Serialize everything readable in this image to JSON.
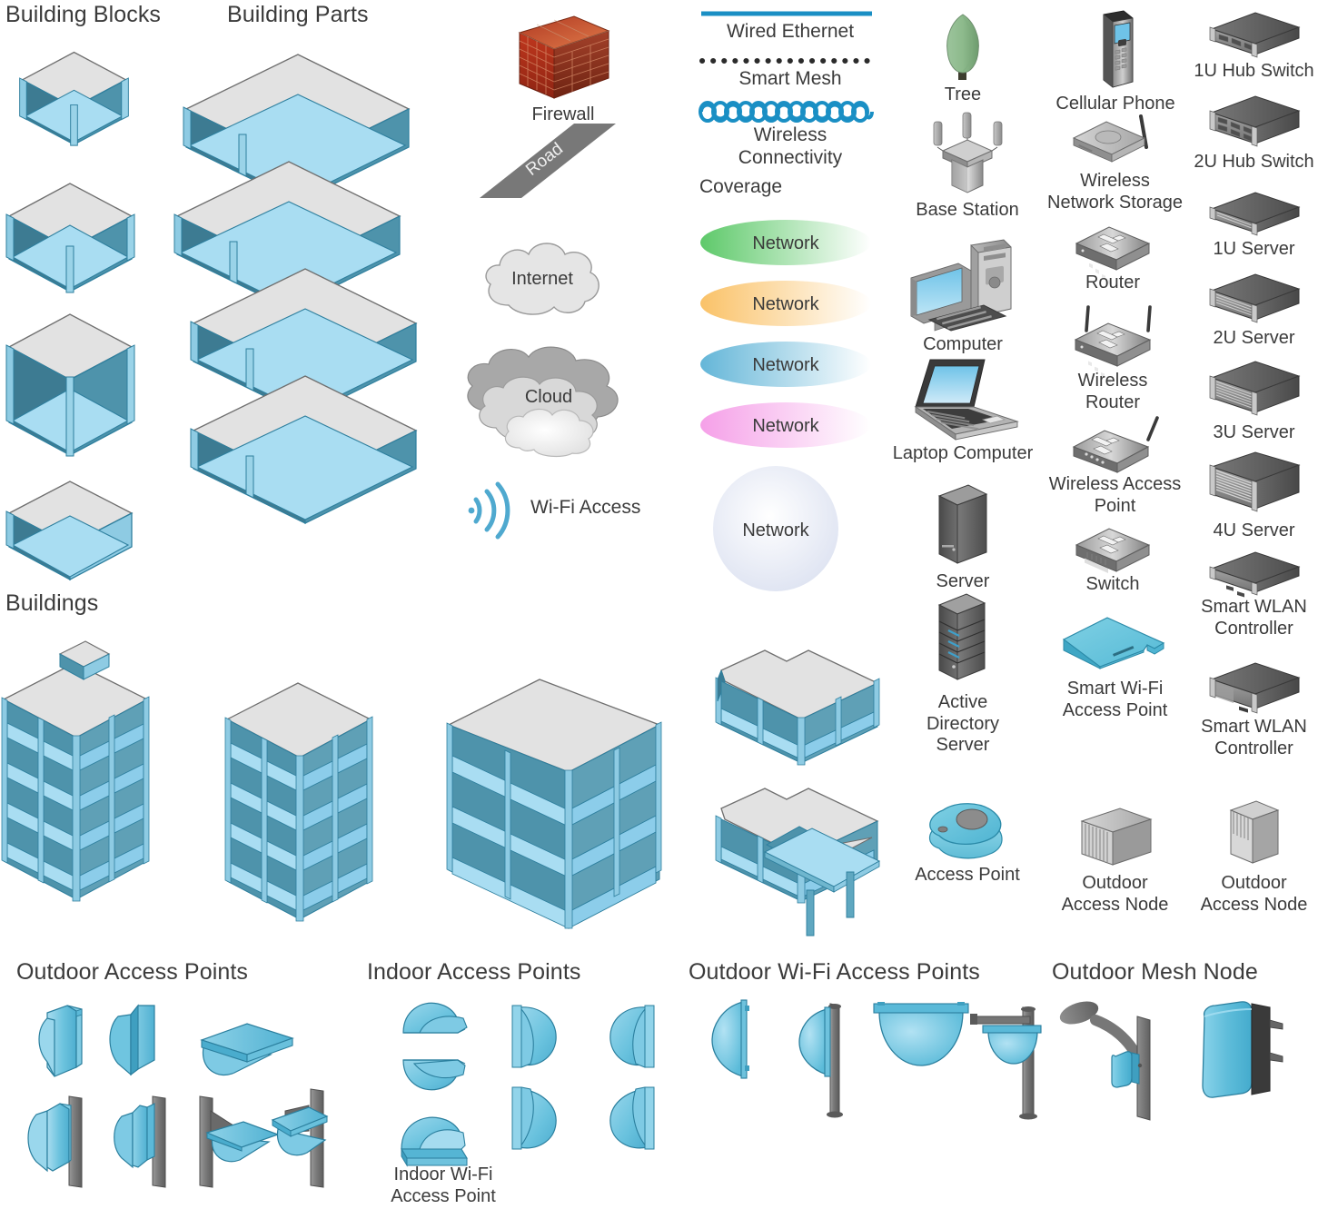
{
  "sections": {
    "building_blocks": "Building Blocks",
    "building_parts": "Building Parts",
    "buildings": "Buildings",
    "outdoor_access_points": "Outdoor Access Points",
    "indoor_access_points": "Indoor Access Points",
    "outdoor_wifi_access_points": "Outdoor Wi-Fi Access Points",
    "outdoor_mesh_node": "Outdoor Mesh Node"
  },
  "symbols": {
    "firewall": "Firewall",
    "road": "Road",
    "internet": "Internet",
    "cloud": "Cloud",
    "wifi_access": "Wi-Fi Access"
  },
  "links": {
    "wired_ethernet": "Wired Ethernet",
    "smart_mesh": "Smart Mesh",
    "wireless_connectivity": "Wireless\nConnectivity",
    "coverage_heading": "Coverage",
    "coverage": [
      {
        "label": "Network",
        "color": "#5ec96a",
        "shape": "ellipse"
      },
      {
        "label": "Network",
        "color": "#fac268",
        "shape": "ellipse"
      },
      {
        "label": "Network",
        "color": "#64b6d8",
        "shape": "ellipse"
      },
      {
        "label": "Network",
        "color": "#f5a0e8",
        "shape": "ellipse"
      },
      {
        "label": "Network",
        "color": "#dfe4f2",
        "shape": "circle"
      }
    ]
  },
  "devices_col1": [
    {
      "label": "Tree",
      "icon": "tree-icon"
    },
    {
      "label": "Base Station",
      "icon": "base-station-icon"
    },
    {
      "label": "Computer",
      "icon": "computer-icon"
    },
    {
      "label": "Laptop Computer",
      "icon": "laptop-icon"
    },
    {
      "label": "Server",
      "icon": "server-icon"
    },
    {
      "label": "Active\nDirectory\nServer",
      "icon": "active-directory-server-icon"
    },
    {
      "label": "Access Point",
      "icon": "access-point-icon"
    }
  ],
  "devices_col2": [
    {
      "label": "Cellular Phone",
      "icon": "cellular-phone-icon"
    },
    {
      "label": "Wireless\nNetwork Storage",
      "icon": "wireless-network-storage-icon"
    },
    {
      "label": "Router",
      "icon": "router-icon"
    },
    {
      "label": "Wireless\nRouter",
      "icon": "wireless-router-icon"
    },
    {
      "label": "Wireless Access\nPoint",
      "icon": "wireless-access-point-icon"
    },
    {
      "label": "Switch",
      "icon": "switch-icon"
    },
    {
      "label": "Smart Wi-Fi\nAccess Point",
      "icon": "smart-wifi-access-point-icon"
    },
    {
      "label": "Outdoor\nAccess Node",
      "icon": "outdoor-access-node-icon"
    }
  ],
  "devices_col3": [
    {
      "label": "1U Hub Switch",
      "icon": "rack-1u-hub-switch-icon"
    },
    {
      "label": "2U Hub Switch",
      "icon": "rack-2u-hub-switch-icon"
    },
    {
      "label": "1U Server",
      "icon": "rack-1u-server-icon"
    },
    {
      "label": "2U Server",
      "icon": "rack-2u-server-icon"
    },
    {
      "label": "3U Server",
      "icon": "rack-3u-server-icon"
    },
    {
      "label": "4U Server",
      "icon": "rack-4u-server-icon"
    },
    {
      "label": "Smart WLAN\nController",
      "icon": "smart-wlan-controller-1u-icon"
    },
    {
      "label": "Smart WLAN\nController",
      "icon": "smart-wlan-controller-2u-icon"
    },
    {
      "label": "Outdoor\nAccess Node",
      "icon": "outdoor-access-node-tall-icon"
    }
  ],
  "indoor_ap_label": "Indoor Wi-Fi\nAccess Point",
  "colors": {
    "link_blue": "#1a8fc4",
    "floor_light": "#a9ddf2",
    "wall_mid": "#4e93ab",
    "wall_dark": "#3d7b92",
    "edge_blue": "#2e7f9e",
    "roof_gray": "#e2e2e2",
    "roof_edge": "#8c8c8c",
    "device_blue": "#63c3dd",
    "device_blue_dark": "#3a9cb8",
    "gray_pole": "#7a7a7a",
    "text": "#3b3b3b"
  }
}
